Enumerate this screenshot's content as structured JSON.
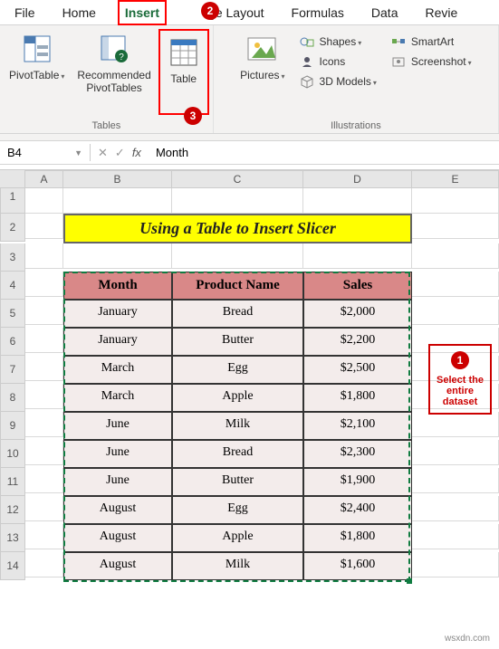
{
  "tabs": [
    "File",
    "Home",
    "Insert",
    "Page Layout",
    "Formulas",
    "Data",
    "Review"
  ],
  "active_tab": "Insert",
  "ribbon": {
    "tables_group": "Tables",
    "pivottable": "PivotTable",
    "rec_pivot": "Recommended\nPivotTables",
    "table": "Table",
    "illustrations_group": "Illustrations",
    "pictures": "Pictures",
    "shapes": "Shapes",
    "icons": "Icons",
    "models": "3D Models",
    "smartart": "SmartArt",
    "screenshot": "Screenshot"
  },
  "namebox": "B4",
  "formula": "Month",
  "columns": [
    "A",
    "B",
    "C",
    "D",
    "E"
  ],
  "rows": [
    "1",
    "2",
    "3",
    "4",
    "5",
    "6",
    "7",
    "8",
    "9",
    "10",
    "11",
    "12",
    "13",
    "14"
  ],
  "title": "Using a Table to Insert Slicer",
  "headers": [
    "Month",
    "Product Name",
    "Sales"
  ],
  "data": [
    [
      "January",
      "Bread",
      "$2,000"
    ],
    [
      "January",
      "Butter",
      "$2,200"
    ],
    [
      "March",
      "Egg",
      "$2,500"
    ],
    [
      "March",
      "Apple",
      "$1,800"
    ],
    [
      "June",
      "Milk",
      "$2,100"
    ],
    [
      "June",
      "Bread",
      "$2,300"
    ],
    [
      "June",
      "Butter",
      "$1,900"
    ],
    [
      "August",
      "Egg",
      "$2,400"
    ],
    [
      "August",
      "Apple",
      "$1,800"
    ],
    [
      "August",
      "Milk",
      "$1,600"
    ]
  ],
  "callout": "Select the entire dataset",
  "badges": {
    "b1": "1",
    "b2": "2",
    "b3": "3"
  },
  "watermark": "wsxdn.com"
}
